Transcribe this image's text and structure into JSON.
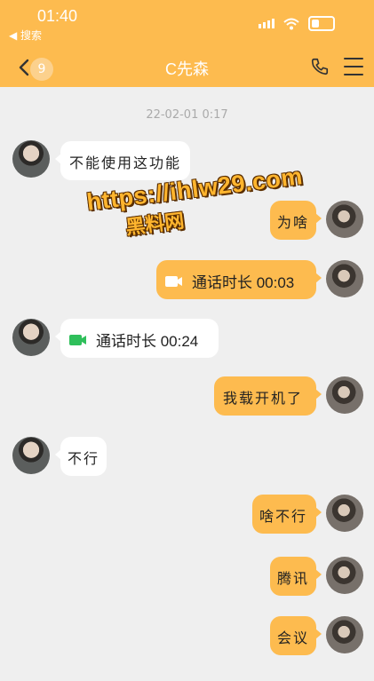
{
  "status_bar": {
    "time": "01:40",
    "back_app": "◀ 搜索"
  },
  "nav": {
    "unread_count": "9",
    "title": "C先森"
  },
  "timestamp": "22-02-01 0:17",
  "messages": [
    {
      "side": "in",
      "text": "不能使用这功能"
    },
    {
      "side": "out",
      "text": "为啥"
    },
    {
      "side": "out",
      "type": "call",
      "text": "通话时长 00:03"
    },
    {
      "side": "in",
      "type": "call",
      "text": "通话时长 00:24"
    },
    {
      "side": "out",
      "text": "我载开机了"
    },
    {
      "side": "in",
      "text": "不行"
    },
    {
      "side": "out",
      "text": "啥不行"
    },
    {
      "side": "out",
      "text": "腾讯"
    },
    {
      "side": "out",
      "text": "会议"
    }
  ],
  "watermark": {
    "line1": "https://ihlw29.com",
    "line2": "黑料网"
  },
  "colors": {
    "accent": "#fdbb4f",
    "background": "#efefef",
    "call_icon_green": "#2fbf5b"
  },
  "icons": [
    "back-chevron",
    "phone",
    "menu",
    "video-call",
    "signal",
    "wifi",
    "battery"
  ]
}
